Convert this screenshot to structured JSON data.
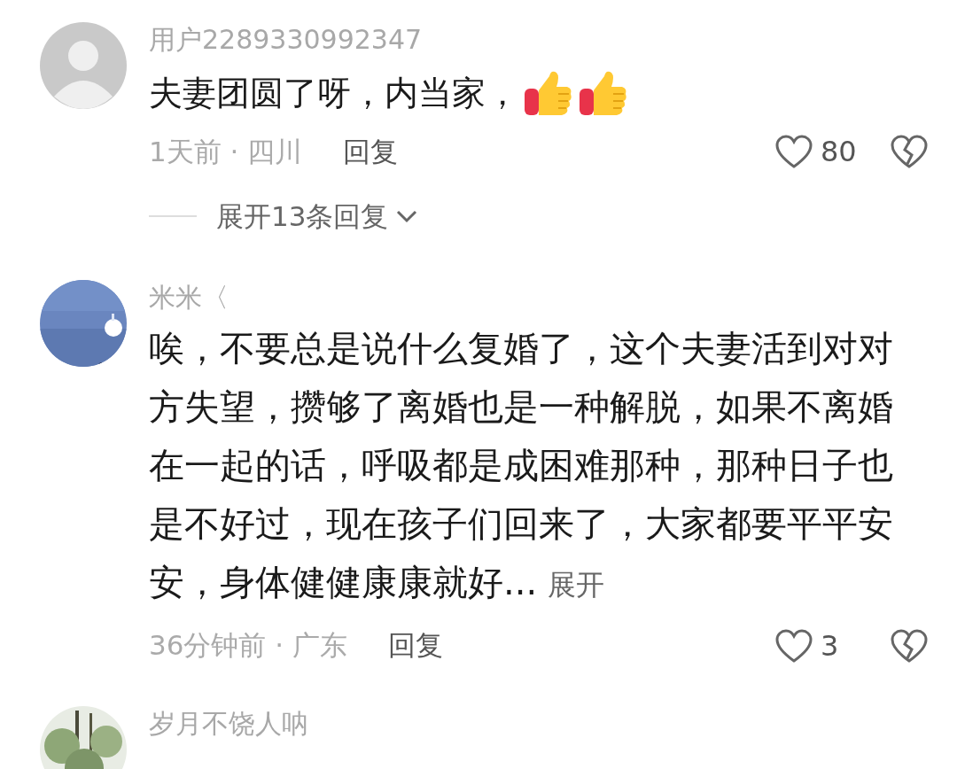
{
  "comments": [
    {
      "avatar": {
        "kind": "default"
      },
      "username": "用户2289330992347",
      "text": "夫妻团圆了呀，内当家，",
      "emojis": [
        {
          "kind": "thumbs_up"
        },
        {
          "kind": "thumbs_up"
        }
      ],
      "meta": "1天前 · 四川",
      "reply": "回复",
      "likes": "80",
      "replies_toggle": "展开13条回复"
    },
    {
      "username": "米米〈",
      "text": "唉，不要总是说什么复婚了，这个夫妻活到对对方失望，攒够了离婚也是一种解脱，如果不离婚在一起的话，呼吸都是成困难那种，那种日子也是不好过，现在孩子们回来了，大家都要平平安安，身体健健康康就好...",
      "more": "展开",
      "meta": "36分钟前 · 广东",
      "reply": "回复",
      "likes": "3"
    },
    {
      "username": "岁月不饶人呐"
    }
  ]
}
